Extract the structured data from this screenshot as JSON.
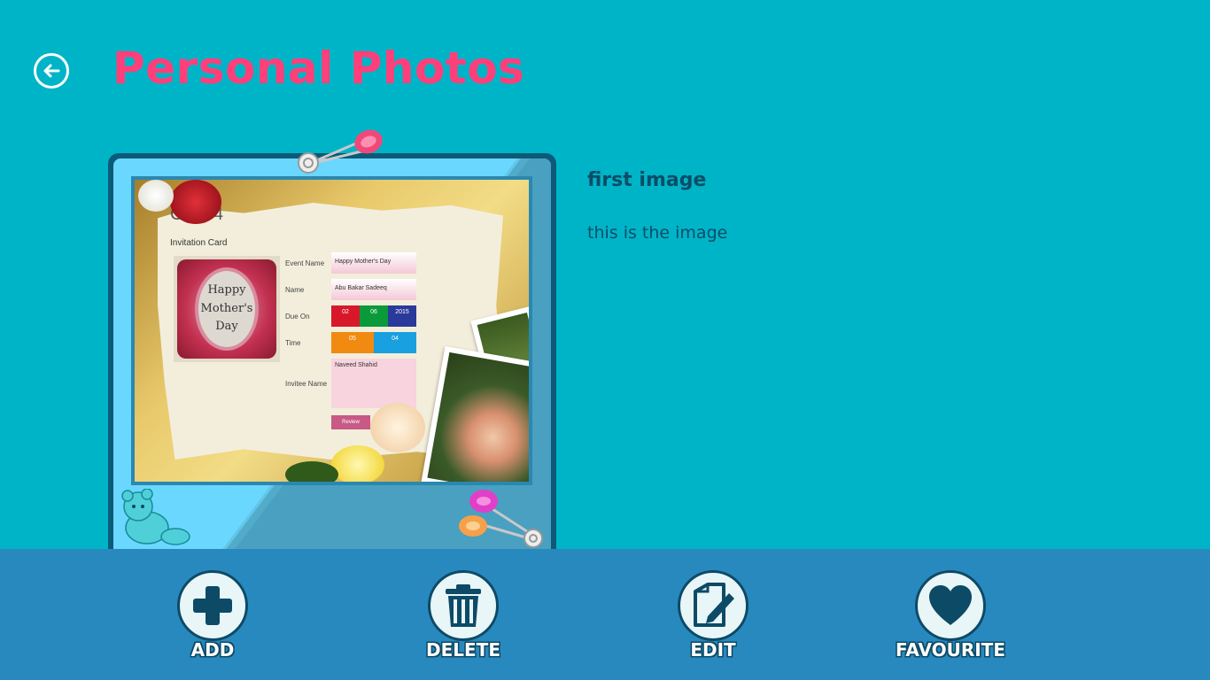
{
  "header": {
    "back_icon": "back-arrow-icon",
    "title": "Personal Photos"
  },
  "photo": {
    "card_title": "Card 4",
    "card_subtitle": "Invitation Card",
    "mothers_day_text": [
      "Happy",
      "Mother's",
      "Day"
    ],
    "fields": {
      "event_name_label": "Event Name",
      "event_name_value": "Happy Mother's Day",
      "name_label": "Name",
      "name_value": "Abu Bakar Sadeeq",
      "due_on_label": "Due On",
      "date_day": "02",
      "date_month": "06",
      "date_year": "2015",
      "time_label": "Time",
      "time_hour": "05",
      "time_minute": "04",
      "invitee_label": "Invitee Name",
      "invitee_value": "Naveed Shahid",
      "review_label": "Review"
    }
  },
  "info": {
    "title": "first image",
    "description": "this is the image"
  },
  "appbar": {
    "buttons": [
      {
        "label": "ADD",
        "icon": "plus-icon"
      },
      {
        "label": "DELETE",
        "icon": "trash-icon"
      },
      {
        "label": "EDIT",
        "icon": "edit-icon"
      },
      {
        "label": "FAVOURITE",
        "icon": "heart-icon"
      }
    ]
  },
  "colors": {
    "background": "#00b4c8",
    "title": "#ff3f7a",
    "appbar": "#2889bf",
    "icon_dark": "#0d4a66"
  }
}
